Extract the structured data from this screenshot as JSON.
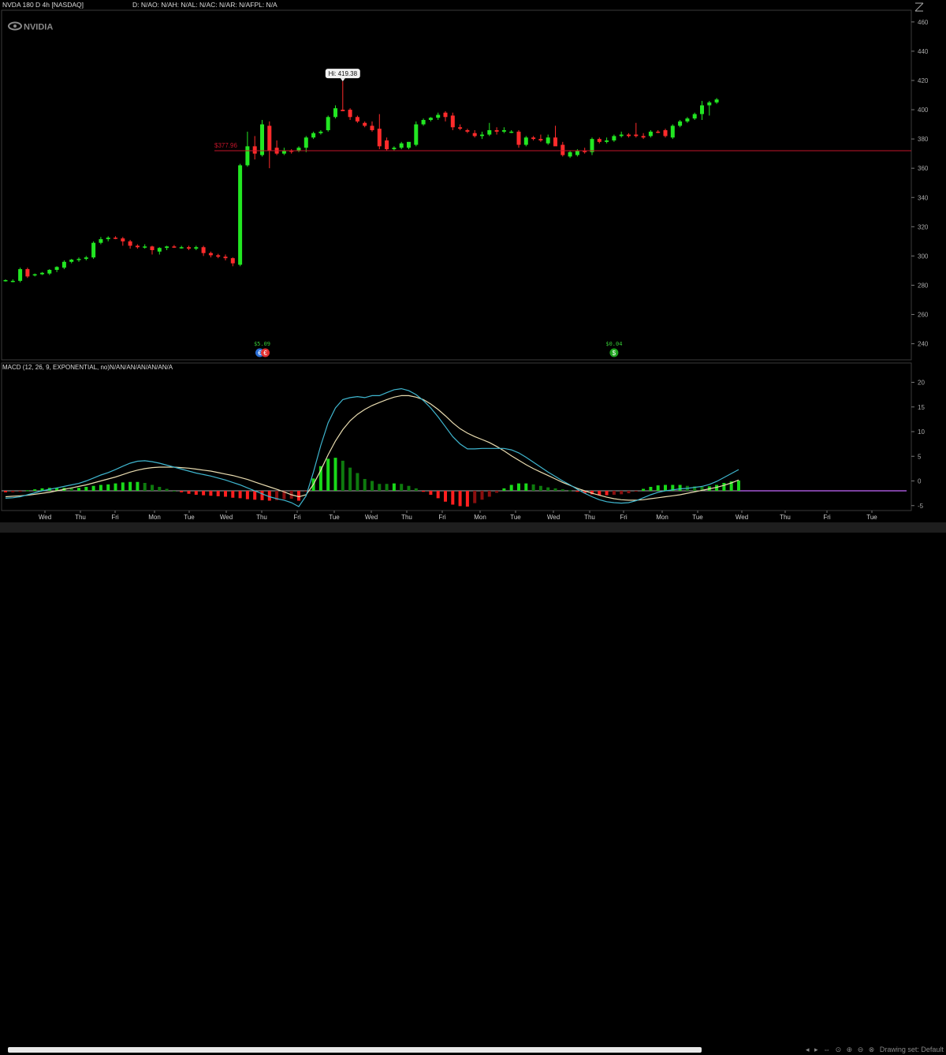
{
  "header": {
    "symbol_label": "NVDA 180 D 4h [NASDAQ]",
    "ohlc_label": "D: N/AO: N/AH: N/AL: N/AC: N/AR: N/AFPL: N/A",
    "watermark": "NVIDIA"
  },
  "macd_panel": {
    "label": "MACD (12, 26, 9, EXPONENTIAL, no)N/AN/AN/AN/AN/AN/A"
  },
  "footer": {
    "drawing_hint": "Drawing set: Default"
  },
  "colors": {
    "up": "#22e622",
    "down": "#ff2b2b",
    "macd_line": "#3fb6cf",
    "signal_line": "#e9dcb0",
    "hist_up_strong": "#19d919",
    "hist_up_weak": "#0e7a0e",
    "hist_down_strong": "#ff1f1f",
    "hist_down_weak": "#8a0f0f",
    "zero_line": "#a455d6",
    "price_line": "#c2142a",
    "grid": "#333"
  },
  "chart_data": [
    {
      "type": "candlestick",
      "title": "NVDA 180 D 4h [NASDAQ]",
      "ylim": [
        229,
        468
      ],
      "yticks": [
        240,
        260,
        280,
        300,
        320,
        340,
        360,
        380,
        400,
        420,
        440,
        460
      ],
      "x_tick_labels": [
        "Wed",
        "Thu",
        "Fri",
        "Mon",
        "Tue",
        "Wed",
        "Thu",
        "Fri",
        "Tue",
        "Wed",
        "Thu",
        "Fri",
        "Mon",
        "Tue",
        "Wed",
        "Thu",
        "Fri",
        "Mon",
        "Tue",
        "Wed",
        "Thu",
        "Fri",
        "Tue"
      ],
      "candles": [
        {
          "o": 283,
          "h": 284,
          "l": 282.5,
          "c": 283.5
        },
        {
          "o": 283,
          "h": 284,
          "l": 282,
          "c": 283
        },
        {
          "o": 283,
          "h": 292,
          "l": 282,
          "c": 291
        },
        {
          "o": 291,
          "h": 292,
          "l": 285,
          "c": 286
        },
        {
          "o": 287,
          "h": 288,
          "l": 286,
          "c": 287.5
        },
        {
          "o": 287.5,
          "h": 289,
          "l": 287,
          "c": 288.5
        },
        {
          "o": 288,
          "h": 291,
          "l": 287,
          "c": 290.5
        },
        {
          "o": 290.5,
          "h": 293,
          "l": 289,
          "c": 292.5
        },
        {
          "o": 292,
          "h": 297,
          "l": 291,
          "c": 296
        },
        {
          "o": 296,
          "h": 298,
          "l": 295,
          "c": 297.5
        },
        {
          "o": 297.5,
          "h": 299,
          "l": 296,
          "c": 298
        },
        {
          "o": 298,
          "h": 300,
          "l": 297,
          "c": 299
        },
        {
          "o": 299,
          "h": 310,
          "l": 298,
          "c": 309
        },
        {
          "o": 309,
          "h": 313,
          "l": 308,
          "c": 311.5
        },
        {
          "o": 311.5,
          "h": 313.5,
          "l": 310,
          "c": 312.5
        },
        {
          "o": 312.5,
          "h": 313.5,
          "l": 311.5,
          "c": 312
        },
        {
          "o": 312,
          "h": 313,
          "l": 307,
          "c": 310
        },
        {
          "o": 310,
          "h": 311,
          "l": 305,
          "c": 307
        },
        {
          "o": 307,
          "h": 308,
          "l": 305,
          "c": 306
        },
        {
          "o": 306,
          "h": 308,
          "l": 305,
          "c": 306.5
        },
        {
          "o": 306.5,
          "h": 307,
          "l": 301,
          "c": 304
        },
        {
          "o": 303,
          "h": 306,
          "l": 301,
          "c": 305.5
        },
        {
          "o": 305.5,
          "h": 307,
          "l": 304,
          "c": 306.5
        },
        {
          "o": 306.5,
          "h": 307.5,
          "l": 305.5,
          "c": 306
        },
        {
          "o": 306,
          "h": 307,
          "l": 305,
          "c": 306
        },
        {
          "o": 306,
          "h": 307,
          "l": 304,
          "c": 305
        },
        {
          "o": 305,
          "h": 307,
          "l": 304,
          "c": 306
        },
        {
          "o": 306,
          "h": 307,
          "l": 300,
          "c": 302
        },
        {
          "o": 302,
          "h": 303,
          "l": 299,
          "c": 300.5
        },
        {
          "o": 300.5,
          "h": 301.5,
          "l": 298.5,
          "c": 299.5
        },
        {
          "o": 299.5,
          "h": 301,
          "l": 297,
          "c": 298.5
        },
        {
          "o": 298.5,
          "h": 299,
          "l": 293,
          "c": 295
        },
        {
          "o": 294,
          "h": 363,
          "l": 293,
          "c": 362
        },
        {
          "o": 362,
          "h": 385,
          "l": 361,
          "c": 375
        },
        {
          "o": 375,
          "h": 382,
          "l": 366,
          "c": 370
        },
        {
          "o": 369,
          "h": 393,
          "l": 368,
          "c": 390
        },
        {
          "o": 389,
          "h": 392,
          "l": 360,
          "c": 372
        },
        {
          "o": 374,
          "h": 379,
          "l": 369,
          "c": 370
        },
        {
          "o": 370,
          "h": 374,
          "l": 369,
          "c": 372
        },
        {
          "o": 372,
          "h": 373,
          "l": 370,
          "c": 371.5
        },
        {
          "o": 372,
          "h": 375,
          "l": 371,
          "c": 374
        },
        {
          "o": 374,
          "h": 382,
          "l": 371,
          "c": 381
        },
        {
          "o": 381,
          "h": 385,
          "l": 380,
          "c": 384
        },
        {
          "o": 384,
          "h": 386,
          "l": 383,
          "c": 385
        },
        {
          "o": 386,
          "h": 396,
          "l": 385,
          "c": 395
        },
        {
          "o": 395,
          "h": 403,
          "l": 394,
          "c": 401
        },
        {
          "o": 400,
          "h": 419.38,
          "l": 399,
          "c": 399
        },
        {
          "o": 400,
          "h": 401,
          "l": 393,
          "c": 395
        },
        {
          "o": 395,
          "h": 396,
          "l": 391,
          "c": 392
        },
        {
          "o": 391,
          "h": 392,
          "l": 388,
          "c": 389
        },
        {
          "o": 389,
          "h": 392,
          "l": 385,
          "c": 386
        },
        {
          "o": 387,
          "h": 397,
          "l": 373,
          "c": 375
        },
        {
          "o": 379,
          "h": 381,
          "l": 372,
          "c": 373
        },
        {
          "o": 373,
          "h": 375,
          "l": 372,
          "c": 374
        },
        {
          "o": 374,
          "h": 378,
          "l": 373,
          "c": 377
        },
        {
          "o": 374,
          "h": 378,
          "l": 373,
          "c": 378
        },
        {
          "o": 376,
          "h": 392,
          "l": 375,
          "c": 390
        },
        {
          "o": 390,
          "h": 394,
          "l": 389,
          "c": 393
        },
        {
          "o": 393,
          "h": 395,
          "l": 392,
          "c": 394.5
        },
        {
          "o": 394.5,
          "h": 398,
          "l": 393,
          "c": 396.5
        },
        {
          "o": 398,
          "h": 399,
          "l": 392,
          "c": 395
        },
        {
          "o": 396,
          "h": 398,
          "l": 386,
          "c": 388
        },
        {
          "o": 388,
          "h": 390,
          "l": 386,
          "c": 387
        },
        {
          "o": 386,
          "h": 387,
          "l": 384,
          "c": 385
        },
        {
          "o": 384,
          "h": 386,
          "l": 381,
          "c": 382
        },
        {
          "o": 382,
          "h": 385,
          "l": 380,
          "c": 383
        },
        {
          "o": 383,
          "h": 391,
          "l": 382,
          "c": 386
        },
        {
          "o": 386,
          "h": 388,
          "l": 383,
          "c": 385
        },
        {
          "o": 385,
          "h": 388,
          "l": 384,
          "c": 386
        },
        {
          "o": 385,
          "h": 386,
          "l": 384,
          "c": 385
        },
        {
          "o": 385,
          "h": 386,
          "l": 374,
          "c": 376
        },
        {
          "o": 376,
          "h": 382,
          "l": 375,
          "c": 381
        },
        {
          "o": 381,
          "h": 382,
          "l": 379,
          "c": 380
        },
        {
          "o": 380,
          "h": 383,
          "l": 378,
          "c": 379
        },
        {
          "o": 377,
          "h": 383,
          "l": 376,
          "c": 381
        },
        {
          "o": 381,
          "h": 389,
          "l": 376,
          "c": 375
        },
        {
          "o": 376,
          "h": 378,
          "l": 368,
          "c": 369
        },
        {
          "o": 368,
          "h": 372,
          "l": 367,
          "c": 371
        },
        {
          "o": 369,
          "h": 373,
          "l": 368,
          "c": 372
        },
        {
          "o": 372,
          "h": 374,
          "l": 370,
          "c": 371
        },
        {
          "o": 371,
          "h": 381,
          "l": 369,
          "c": 380
        },
        {
          "o": 380,
          "h": 381,
          "l": 377,
          "c": 378
        },
        {
          "o": 378,
          "h": 381,
          "l": 377,
          "c": 379
        },
        {
          "o": 379,
          "h": 383,
          "l": 378,
          "c": 382
        },
        {
          "o": 382,
          "h": 385,
          "l": 381,
          "c": 383
        },
        {
          "o": 383,
          "h": 384,
          "l": 381,
          "c": 382
        },
        {
          "o": 383,
          "h": 391,
          "l": 381,
          "c": 382
        },
        {
          "o": 382,
          "h": 384,
          "l": 380,
          "c": 381
        },
        {
          "o": 382,
          "h": 386,
          "l": 381,
          "c": 385
        },
        {
          "o": 385,
          "h": 386,
          "l": 384,
          "c": 384.5
        },
        {
          "o": 386,
          "h": 387,
          "l": 381,
          "c": 382
        },
        {
          "o": 381,
          "h": 390,
          "l": 380,
          "c": 389
        },
        {
          "o": 389,
          "h": 393,
          "l": 388,
          "c": 392
        },
        {
          "o": 392,
          "h": 395,
          "l": 391,
          "c": 394
        },
        {
          "o": 394,
          "h": 398,
          "l": 393,
          "c": 397
        },
        {
          "o": 397,
          "h": 406,
          "l": 393,
          "c": 403
        },
        {
          "o": 403,
          "h": 406,
          "l": 396,
          "c": 405
        },
        {
          "o": 405,
          "h": 408,
          "l": 404,
          "c": 407
        }
      ],
      "price_line": {
        "value": 372,
        "label": "$377.96"
      },
      "annotations": [
        {
          "type": "high",
          "label": "Hi: 419.38",
          "candle_index": 46
        },
        {
          "type": "event",
          "label": "$5.09",
          "candle_index": 35
        },
        {
          "type": "event",
          "label": "$0.04",
          "candle_index": 83
        }
      ]
    },
    {
      "type": "macd",
      "title": "MACD (12, 26, 9, EXPONENTIAL, no)N/AN/AN/AN/AN/AN/A",
      "ylim": [
        -6,
        22
      ],
      "yticks": [
        -5,
        0,
        5,
        10,
        15,
        20
      ],
      "macd": [
        -1.5,
        -1.4,
        -1.2,
        -0.8,
        -0.4,
        0,
        0.3,
        0.6,
        0.9,
        1.2,
        1.5,
        2.0,
        2.6,
        3.2,
        3.7,
        4.3,
        5,
        5.6,
        6,
        6.1,
        5.9,
        5.6,
        5.2,
        4.8,
        4.4,
        4.0,
        3.6,
        3.3,
        3,
        2.6,
        2.2,
        1.7,
        1.2,
        0.6,
        0,
        -0.6,
        -1.2,
        -1.6,
        -1.9,
        -2.4,
        -3.2,
        -1.0,
        3.8,
        9.2,
        13.8,
        16.8,
        18.5,
        18.9,
        19.1,
        18.9,
        19.3,
        19.3,
        19.9,
        20.5,
        20.7,
        20.3,
        19.5,
        18.3,
        16.8,
        15,
        13,
        11.0,
        9.5,
        8.5,
        8.5,
        8.6,
        8.6,
        8.6,
        8.6,
        8.3,
        7.7,
        6.8,
        5.8,
        4.8,
        3.8,
        2.9,
        2.0,
        1.2,
        0.3,
        -0.5,
        -1.2,
        -1.8,
        -2.2,
        -2.4,
        -2.5,
        -2.4,
        -2.0,
        -1.4,
        -0.8,
        -0.3,
        0.0,
        0.2,
        0.4,
        0.5,
        0.7,
        0.9,
        1.3,
        1.9,
        2.7,
        3.5,
        4.3
      ],
      "signal": [
        -1.2,
        -1.1,
        -1.0,
        -0.9,
        -0.7,
        -0.5,
        -0.3,
        0,
        0.3,
        0.6,
        0.9,
        1.2,
        1.6,
        2.0,
        2.4,
        2.8,
        3.3,
        3.8,
        4.2,
        4.5,
        4.7,
        4.8,
        4.8,
        4.8,
        4.7,
        4.6,
        4.4,
        4.2,
        4.0,
        3.7,
        3.4,
        3.1,
        2.7,
        2.3,
        1.8,
        1.3,
        0.8,
        0.3,
        -0.2,
        -0.8,
        -1.2,
        -0.8,
        1.3,
        4.2,
        7.3,
        10.1,
        12.4,
        14.2,
        15.5,
        16.5,
        17.3,
        17.9,
        18.5,
        19.0,
        19.3,
        19.3,
        19.0,
        18.5,
        17.6,
        16.5,
        15.2,
        13.8,
        12.6,
        11.7,
        11.0,
        10.4,
        9.8,
        9.0,
        8.1,
        7.1,
        6.2,
        5.3,
        4.5,
        3.8,
        3.1,
        2.4,
        1.7,
        1.1,
        0.5,
        0.0,
        -0.5,
        -0.9,
        -1.3,
        -1.6,
        -1.8,
        -1.9,
        -1.9,
        -1.8,
        -1.6,
        -1.4,
        -1.2,
        -1.0,
        -0.8,
        -0.5,
        -0.2,
        0.1,
        0.4,
        0.7,
        1.1,
        1.6,
        2.2
      ]
    }
  ]
}
